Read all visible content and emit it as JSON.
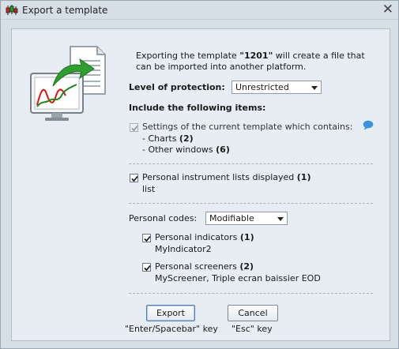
{
  "window": {
    "title": "Export a template",
    "close_icon": "close-icon",
    "app_icon": "candlestick-icon"
  },
  "description": {
    "before": "Exporting the template ",
    "template_name": "\"1201\"",
    "after": " will create a file that can be imported into another platform."
  },
  "protection": {
    "label": "Level of protection:",
    "value": "Unrestricted"
  },
  "include": {
    "heading": "Include the following items:",
    "settings_label": "Settings of the current template which contains:",
    "info_icon": "speech-bubble-icon",
    "charts_label": "- Charts ",
    "charts_count": "(2)",
    "other_label": "- Other windows ",
    "other_count": "(6)"
  },
  "instrument_lists": {
    "label": "Personal instrument lists displayed ",
    "count": "(1)",
    "value": "list"
  },
  "personal_codes": {
    "label": "Personal codes:",
    "value": "Modifiable"
  },
  "indicators": {
    "label": "Personal indicators ",
    "count": "(1)",
    "value": "MyIndicator2"
  },
  "screeners": {
    "label": "Personal screeners ",
    "count": "(2)",
    "value": "MyScreener, Triple ecran baissier EOD"
  },
  "buttons": {
    "export_label": "Export",
    "export_hint": "\"Enter/Spacebar\" key",
    "cancel_label": "Cancel",
    "cancel_hint": "\"Esc\" key"
  },
  "colors": {
    "accent": "#4d7fb8",
    "panel": "#e7edf2",
    "window": "#d6dee6"
  }
}
